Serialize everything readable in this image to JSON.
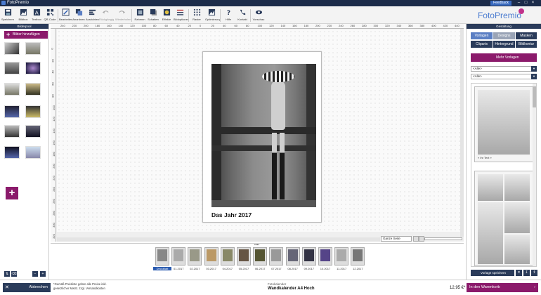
{
  "app": {
    "title": "FotoPremio",
    "feedback_label": "Feedback",
    "brand": "FotoPremio"
  },
  "toolbar": {
    "items": [
      {
        "label": "Speichern",
        "icon": "save-icon"
      },
      {
        "label": "Bildbox",
        "icon": "image-box-icon"
      },
      {
        "label": "Textbox",
        "icon": "text-box-icon"
      },
      {
        "label": "QR-Code",
        "icon": "qr-code-icon"
      },
      {
        "label": "Bearbeiten",
        "icon": "edit-icon"
      },
      {
        "label": "Anordnen",
        "icon": "arrange-icon"
      },
      {
        "label": "Ausrichten",
        "icon": "align-icon"
      },
      {
        "label": "Rückgängig",
        "icon": "undo-icon"
      },
      {
        "label": "Wiederholen",
        "icon": "redo-icon"
      },
      {
        "label": "Rahmen",
        "icon": "frame-icon"
      },
      {
        "label": "Schatten",
        "icon": "shadow-icon"
      },
      {
        "label": "Effekte",
        "icon": "effects-icon"
      },
      {
        "label": "Bildoptionen",
        "icon": "image-options-icon"
      },
      {
        "label": "Raster",
        "icon": "grid-icon"
      },
      {
        "label": "Optimierung",
        "icon": "optimize-icon"
      },
      {
        "label": "Hilfe",
        "icon": "help-icon"
      },
      {
        "label": "Kontakt",
        "icon": "phone-icon"
      },
      {
        "label": "Vorschau",
        "icon": "preview-icon"
      }
    ]
  },
  "left_panel": {
    "header": "Bilderpool",
    "add_button": "Bilder hinzufügen"
  },
  "ruler": {
    "top_ticks": [
      "240",
      "220",
      "200",
      "180",
      "160",
      "140",
      "120",
      "100",
      "80",
      "60",
      "40",
      "20",
      "0",
      "20",
      "40",
      "60",
      "80",
      "100",
      "120",
      "140",
      "160",
      "180",
      "200",
      "220",
      "240",
      "260",
      "280",
      "300",
      "320",
      "340",
      "360",
      "380",
      "400",
      "420",
      "440",
      "460"
    ],
    "left_ticks": [
      "0",
      "20",
      "40",
      "60",
      "80",
      "100",
      "120",
      "140",
      "160",
      "180",
      "200",
      "220",
      "240",
      "260",
      "280",
      "300",
      "320"
    ]
  },
  "page": {
    "title": "Das Jahr 2017"
  },
  "zoom": {
    "value": "Ganze Seite"
  },
  "pages": [
    {
      "label": "Deckblatt",
      "selected": true
    },
    {
      "label": "01.2017"
    },
    {
      "label": "02.2017"
    },
    {
      "label": "03.2017"
    },
    {
      "label": "04.2017"
    },
    {
      "label": "05.2017"
    },
    {
      "label": "06.2017"
    },
    {
      "label": "07.2017"
    },
    {
      "label": "08.2017"
    },
    {
      "label": "09.2017"
    },
    {
      "label": "10.2017"
    },
    {
      "label": "11.2017"
    },
    {
      "label": "12.2017"
    }
  ],
  "right_panel": {
    "header": "Gestaltung",
    "tabs_row1": [
      "Vorlagen",
      "Designs",
      "Masken"
    ],
    "tabs_row2": [
      "Cliparts",
      "Hintergrund",
      "Bildkontur"
    ],
    "more_button": "Mehr Vorlagen",
    "filter1": "<Alle>",
    "filter2": "<Alle>",
    "template_caption": "« Ihr Text »",
    "save_templates": "Vorlage speichern"
  },
  "footer": {
    "cancel": "Abbrechen",
    "note_line1": "*Gemäß Preisliste gelten alle Preise inkl.",
    "note_line2": "gesetzlicher MwSt. zzgl. Versandkosten",
    "product_category": "Fotokalender",
    "product_name": "Wandkalender A4 Hoch",
    "price": "12,95 €*",
    "cart": "In den Warenkorb"
  },
  "colors": {
    "primary_dark": "#2a3b5a",
    "accent_magenta": "#8b1a6b",
    "tab_active": "#5b7fc4"
  }
}
